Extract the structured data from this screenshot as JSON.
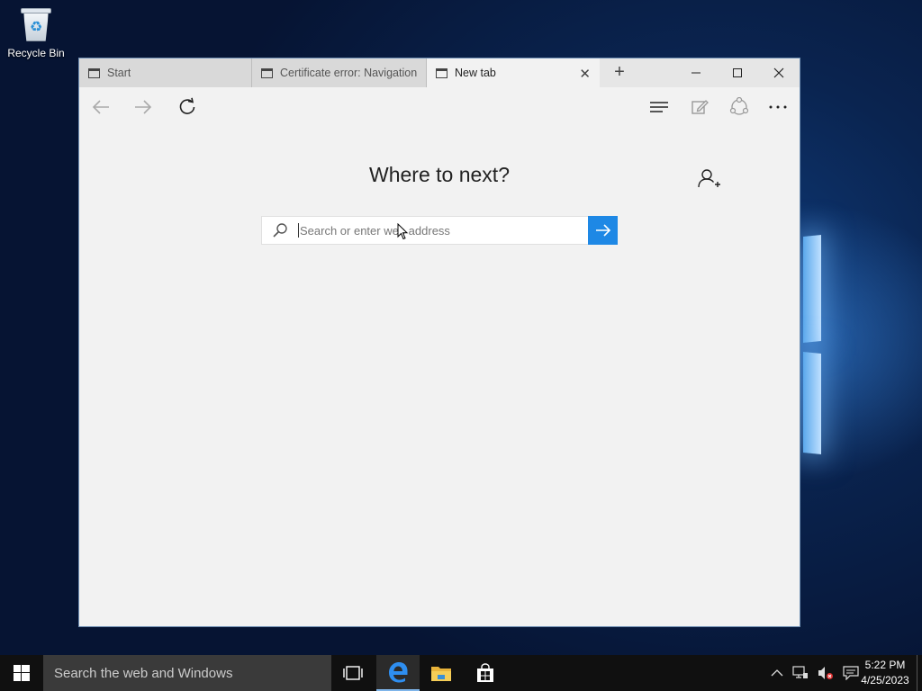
{
  "desktop": {
    "recycle_bin_label": "Recycle Bin"
  },
  "browser": {
    "tabs": [
      {
        "label": "Start",
        "active": false
      },
      {
        "label": "Certificate error: Navigation",
        "active": false
      },
      {
        "label": "New tab",
        "active": true
      }
    ],
    "new_tab_symbol": "+",
    "caption": {
      "minimize": "minimize-icon",
      "maximize": "maximize-icon",
      "close": "close-icon"
    },
    "nav": {
      "back": "back-arrow-icon",
      "forward": "forward-arrow-icon",
      "refresh": "refresh-icon",
      "hub": "hub-icon",
      "note": "web-note-icon",
      "share": "share-icon",
      "more": "more-icon"
    },
    "new_tab_page": {
      "heading": "Where to next?",
      "search_placeholder": "Search or enter web address",
      "search_value": ""
    }
  },
  "taskbar": {
    "search_text": "Search the web and Windows",
    "clock_time": "5:22 PM",
    "clock_date": "4/25/2023",
    "apps": [
      "task-view-icon",
      "edge-icon",
      "file-explorer-icon",
      "store-icon"
    ]
  },
  "colors": {
    "accent": "#1e88e5",
    "taskbar": "#101010",
    "browser_bg": "#f2f2f2"
  }
}
